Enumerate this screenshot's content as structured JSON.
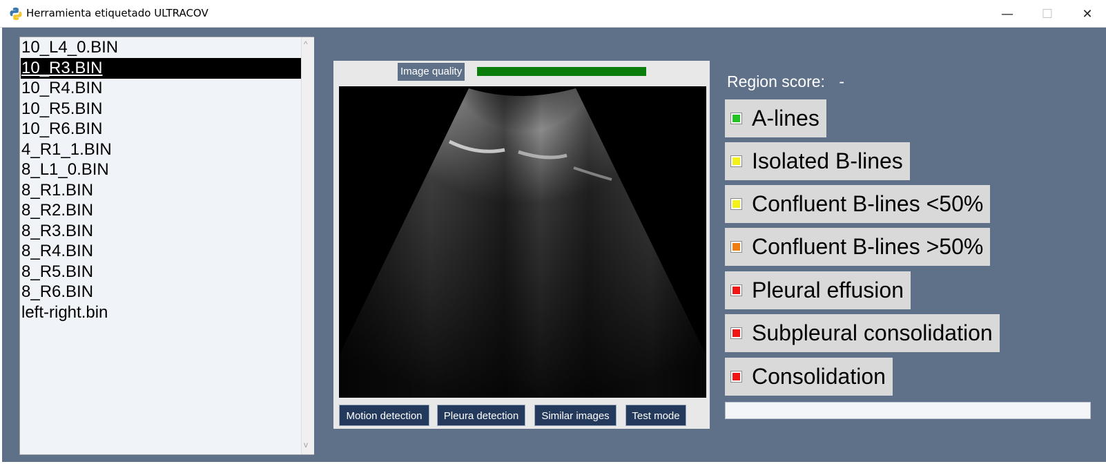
{
  "window": {
    "title": "Herramienta etiquetado ULTRACOV",
    "minimize_glyph": "—",
    "maximize_glyph": "☐",
    "close_glyph": "✕"
  },
  "file_list": {
    "items": [
      "10_L4_0.BIN",
      "10_R3.BIN",
      "10_R4.BIN",
      "10_R5.BIN",
      "10_R6.BIN",
      "4_R1_1.BIN",
      "8_L1_0.BIN",
      "8_R1.BIN",
      "8_R2.BIN",
      "8_R3.BIN",
      "8_R4.BIN",
      "8_R5.BIN",
      "8_R6.BIN",
      "left-right.bin"
    ],
    "selected_index": 1,
    "scroll_up_glyph": "^",
    "scroll_down_glyph": "v"
  },
  "image_panel": {
    "quality_label": "Image quality",
    "quality_fraction": 1.0,
    "quality_color": "#0a7d0a",
    "buttons": [
      "Motion detection",
      "Pleura detection",
      "Similar images",
      "Test mode"
    ]
  },
  "region_score": {
    "label": "Region score:",
    "value": "-"
  },
  "findings": [
    {
      "label": "A-lines",
      "color": "#22c322"
    },
    {
      "label": "Isolated B-lines",
      "color": "#f2f21a"
    },
    {
      "label": "Confluent B-lines <50%",
      "color": "#f2f21a"
    },
    {
      "label": "Confluent B-lines >50%",
      "color": "#f07d12"
    },
    {
      "label": "Pleural effusion",
      "color": "#f01616"
    },
    {
      "label": "Subpleural consolidation",
      "color": "#f01616"
    },
    {
      "label": "Consolidation",
      "color": "#f01616"
    }
  ],
  "accent": {
    "background": "#5f7189",
    "button": "#243a5c"
  }
}
